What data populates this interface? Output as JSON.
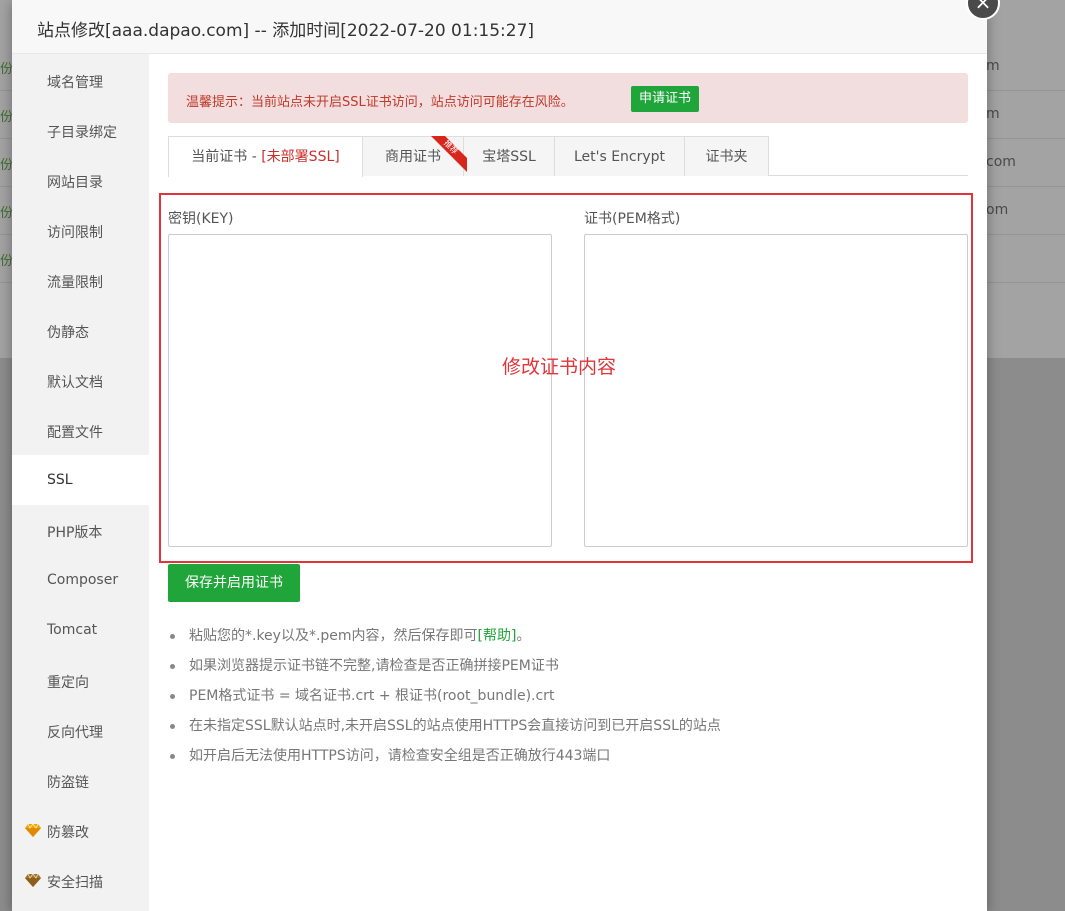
{
  "background": {
    "rows": [
      {
        "left": "份",
        "right": "m"
      },
      {
        "left": "份",
        "right": "m"
      },
      {
        "left": "份",
        "right": "com"
      },
      {
        "left": "份",
        "right": "om"
      },
      {
        "left": "份",
        "right": ""
      }
    ]
  },
  "modal": {
    "title": "站点修改[aaa.dapao.com] -- 添加时间[2022-07-20 01:15:27]",
    "close_symbol": "×"
  },
  "sidebar": {
    "items": [
      {
        "label": "域名管理"
      },
      {
        "label": "子目录绑定"
      },
      {
        "label": "网站目录"
      },
      {
        "label": "访问限制"
      },
      {
        "label": "流量限制"
      },
      {
        "label": "伪静态"
      },
      {
        "label": "默认文档"
      },
      {
        "label": "配置文件"
      },
      {
        "label": "SSL",
        "active": true
      },
      {
        "label": "PHP版本"
      },
      {
        "label": "Composer"
      },
      {
        "label": "Tomcat"
      },
      {
        "label": "重定向"
      },
      {
        "label": "反向代理"
      },
      {
        "label": "防盗链"
      },
      {
        "label": "防篡改",
        "icon": "diamond-icon"
      },
      {
        "label": "安全扫描",
        "icon": "diamond-icon"
      }
    ]
  },
  "alert": {
    "text": "温馨提示：当前站点未开启SSL证书访问，站点访问可能存在风险。",
    "button": "申请证书"
  },
  "tabs": {
    "current_prefix": "当前证书 - ",
    "current_status": "[未部署SSL]",
    "commercial": "商用证书",
    "recommend_badge": "推荐",
    "baota": "宝塔SSL",
    "letsencrypt": "Let's Encrypt",
    "folder": "证书夹"
  },
  "form": {
    "key_label": "密钥(KEY)",
    "key_value": "",
    "cert_label": "证书(PEM格式)",
    "cert_value": "",
    "annotation": "修改证书内容",
    "save_button": "保存并启用证书"
  },
  "tips": {
    "tip1_before": "粘贴您的*.key以及*.pem内容，然后保存即可",
    "tip1_link": "[帮助]",
    "tip1_after": "。",
    "tip2": "如果浏览器提示证书链不完整,请检查是否正确拼接PEM证书",
    "tip3": "PEM格式证书 = 域名证书.crt + 根证书(root_bundle).crt",
    "tip4": "在未指定SSL默认站点时,未开启SSL的站点使用HTTPS会直接访问到已开启SSL的站点",
    "tip5": "如开启后无法使用HTTPS访问，请检查安全组是否正确放行443端口"
  },
  "colors": {
    "brand_green": "#20a53a",
    "warning_red": "#e0353a",
    "alert_bg": "#f2dede",
    "gem_gold": "#f0a30a"
  }
}
